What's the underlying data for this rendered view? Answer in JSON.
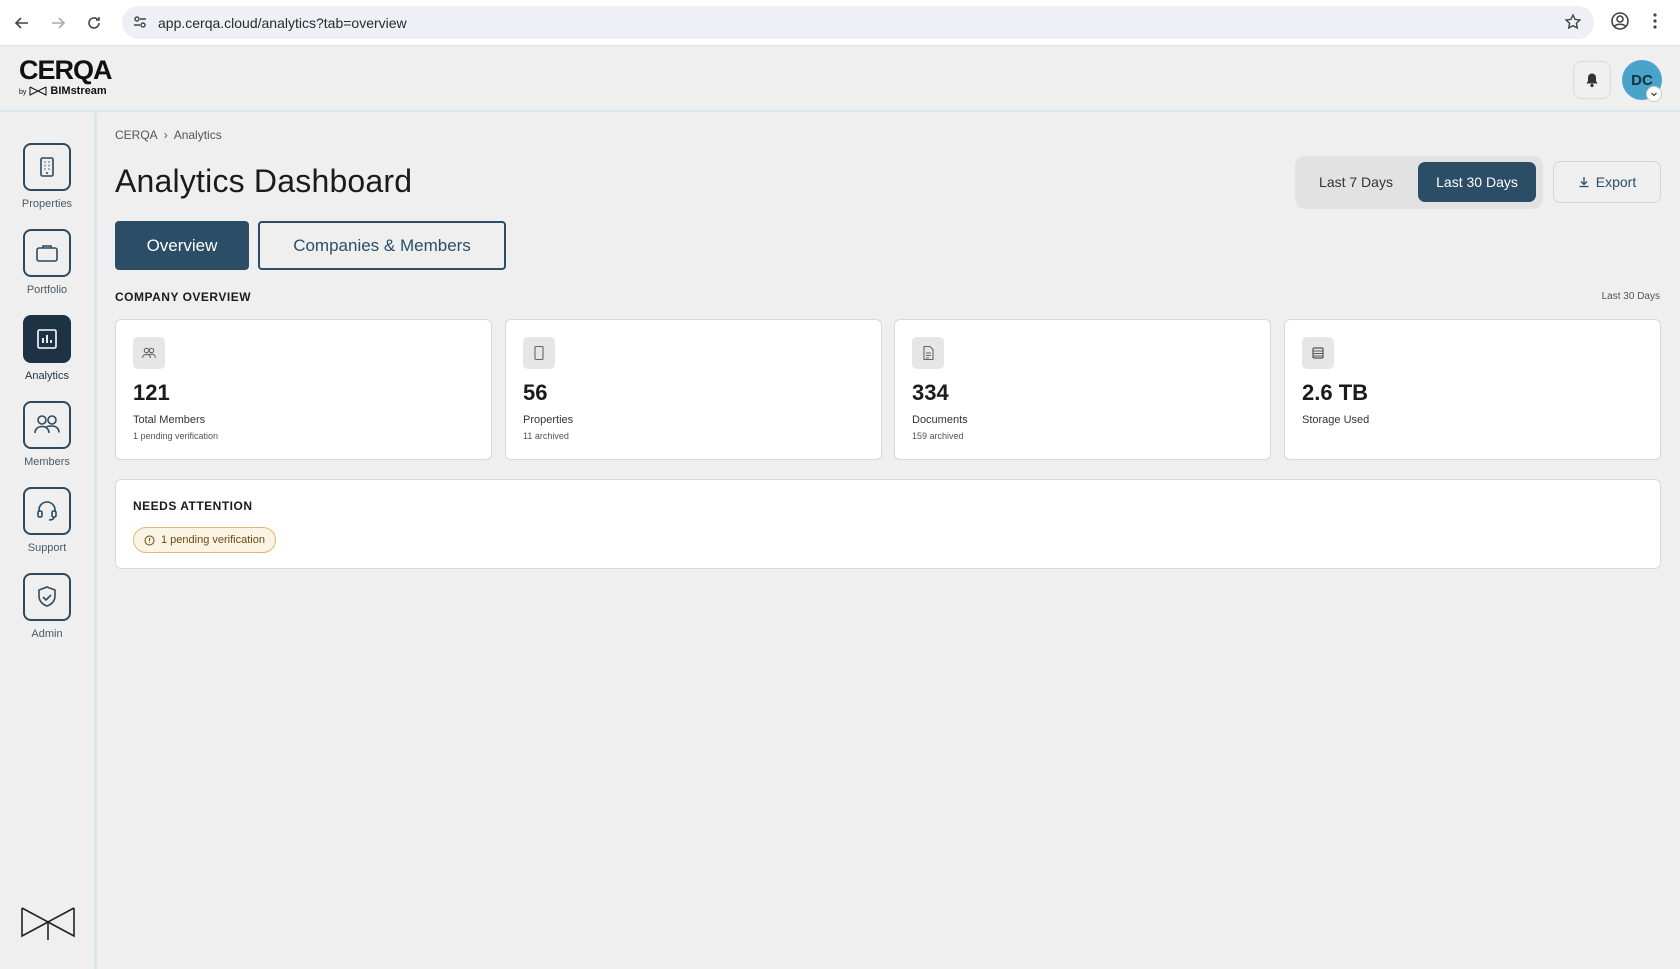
{
  "browser": {
    "url": "app.cerqa.cloud/analytics?tab=overview"
  },
  "header": {
    "logo_main": "CERQA",
    "logo_by": "by",
    "logo_brand": "BIMstream",
    "avatar_initials": "DC"
  },
  "sidebar": {
    "items": [
      {
        "label": "Properties",
        "icon": "building-icon"
      },
      {
        "label": "Portfolio",
        "icon": "briefcase-icon"
      },
      {
        "label": "Analytics",
        "icon": "bar-chart-icon"
      },
      {
        "label": "Members",
        "icon": "users-icon"
      },
      {
        "label": "Support",
        "icon": "headset-icon"
      },
      {
        "label": "Admin",
        "icon": "shield-check-icon"
      }
    ]
  },
  "breadcrumb": [
    "CERQA",
    "›",
    "Analytics"
  ],
  "page": {
    "title": "Analytics Dashboard",
    "range_7": "Last 7 Days",
    "range_30": "Last 30 Days",
    "export_label": "Export",
    "tabs": [
      "Overview",
      "Companies & Members"
    ]
  },
  "overview": {
    "heading": "COMPANY OVERVIEW",
    "range": "Last 30 Days",
    "cards": [
      {
        "value": "121",
        "label": "Total Members",
        "sub": "1 pending verification",
        "icon": "users-icon"
      },
      {
        "value": "56",
        "label": "Properties",
        "sub": "11 archived",
        "icon": "building-icon"
      },
      {
        "value": "334",
        "label": "Documents",
        "sub": "159 archived",
        "icon": "document-icon"
      },
      {
        "value": "2.6 TB",
        "label": "Storage Used",
        "sub": "",
        "icon": "database-icon"
      }
    ]
  },
  "attention": {
    "heading": "NEEDS ATTENTION",
    "pill": "1 pending verification"
  },
  "colors": {
    "primary": "#2b4d66",
    "active_nav": "#1e3246",
    "avatar": "#4aa3c8",
    "warning_bg": "#fbf3e4",
    "warning_border": "#e0b77a"
  }
}
